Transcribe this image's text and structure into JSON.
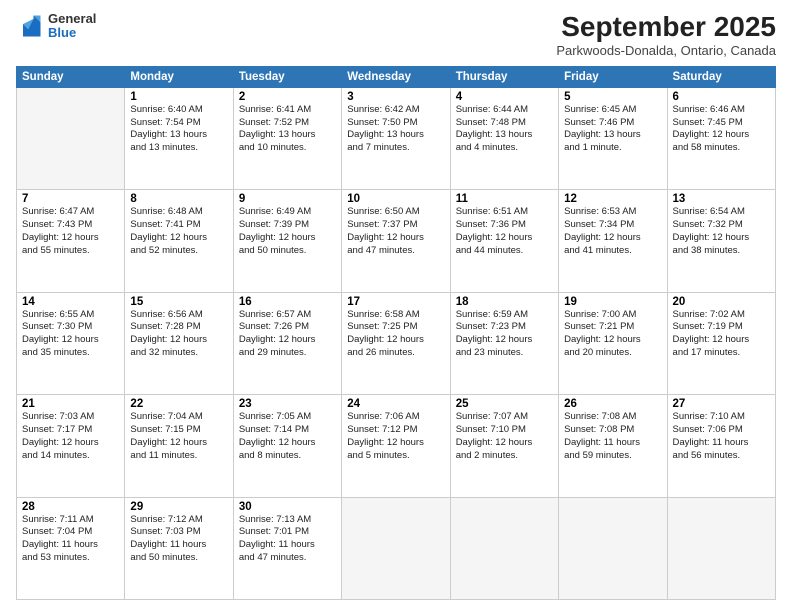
{
  "logo": {
    "general": "General",
    "blue": "Blue"
  },
  "title": "September 2025",
  "location": "Parkwoods-Donalda, Ontario, Canada",
  "days_header": [
    "Sunday",
    "Monday",
    "Tuesday",
    "Wednesday",
    "Thursday",
    "Friday",
    "Saturday"
  ],
  "weeks": [
    [
      {
        "day": "",
        "info": ""
      },
      {
        "day": "1",
        "info": "Sunrise: 6:40 AM\nSunset: 7:54 PM\nDaylight: 13 hours\nand 13 minutes."
      },
      {
        "day": "2",
        "info": "Sunrise: 6:41 AM\nSunset: 7:52 PM\nDaylight: 13 hours\nand 10 minutes."
      },
      {
        "day": "3",
        "info": "Sunrise: 6:42 AM\nSunset: 7:50 PM\nDaylight: 13 hours\nand 7 minutes."
      },
      {
        "day": "4",
        "info": "Sunrise: 6:44 AM\nSunset: 7:48 PM\nDaylight: 13 hours\nand 4 minutes."
      },
      {
        "day": "5",
        "info": "Sunrise: 6:45 AM\nSunset: 7:46 PM\nDaylight: 13 hours\nand 1 minute."
      },
      {
        "day": "6",
        "info": "Sunrise: 6:46 AM\nSunset: 7:45 PM\nDaylight: 12 hours\nand 58 minutes."
      }
    ],
    [
      {
        "day": "7",
        "info": "Sunrise: 6:47 AM\nSunset: 7:43 PM\nDaylight: 12 hours\nand 55 minutes."
      },
      {
        "day": "8",
        "info": "Sunrise: 6:48 AM\nSunset: 7:41 PM\nDaylight: 12 hours\nand 52 minutes."
      },
      {
        "day": "9",
        "info": "Sunrise: 6:49 AM\nSunset: 7:39 PM\nDaylight: 12 hours\nand 50 minutes."
      },
      {
        "day": "10",
        "info": "Sunrise: 6:50 AM\nSunset: 7:37 PM\nDaylight: 12 hours\nand 47 minutes."
      },
      {
        "day": "11",
        "info": "Sunrise: 6:51 AM\nSunset: 7:36 PM\nDaylight: 12 hours\nand 44 minutes."
      },
      {
        "day": "12",
        "info": "Sunrise: 6:53 AM\nSunset: 7:34 PM\nDaylight: 12 hours\nand 41 minutes."
      },
      {
        "day": "13",
        "info": "Sunrise: 6:54 AM\nSunset: 7:32 PM\nDaylight: 12 hours\nand 38 minutes."
      }
    ],
    [
      {
        "day": "14",
        "info": "Sunrise: 6:55 AM\nSunset: 7:30 PM\nDaylight: 12 hours\nand 35 minutes."
      },
      {
        "day": "15",
        "info": "Sunrise: 6:56 AM\nSunset: 7:28 PM\nDaylight: 12 hours\nand 32 minutes."
      },
      {
        "day": "16",
        "info": "Sunrise: 6:57 AM\nSunset: 7:26 PM\nDaylight: 12 hours\nand 29 minutes."
      },
      {
        "day": "17",
        "info": "Sunrise: 6:58 AM\nSunset: 7:25 PM\nDaylight: 12 hours\nand 26 minutes."
      },
      {
        "day": "18",
        "info": "Sunrise: 6:59 AM\nSunset: 7:23 PM\nDaylight: 12 hours\nand 23 minutes."
      },
      {
        "day": "19",
        "info": "Sunrise: 7:00 AM\nSunset: 7:21 PM\nDaylight: 12 hours\nand 20 minutes."
      },
      {
        "day": "20",
        "info": "Sunrise: 7:02 AM\nSunset: 7:19 PM\nDaylight: 12 hours\nand 17 minutes."
      }
    ],
    [
      {
        "day": "21",
        "info": "Sunrise: 7:03 AM\nSunset: 7:17 PM\nDaylight: 12 hours\nand 14 minutes."
      },
      {
        "day": "22",
        "info": "Sunrise: 7:04 AM\nSunset: 7:15 PM\nDaylight: 12 hours\nand 11 minutes."
      },
      {
        "day": "23",
        "info": "Sunrise: 7:05 AM\nSunset: 7:14 PM\nDaylight: 12 hours\nand 8 minutes."
      },
      {
        "day": "24",
        "info": "Sunrise: 7:06 AM\nSunset: 7:12 PM\nDaylight: 12 hours\nand 5 minutes."
      },
      {
        "day": "25",
        "info": "Sunrise: 7:07 AM\nSunset: 7:10 PM\nDaylight: 12 hours\nand 2 minutes."
      },
      {
        "day": "26",
        "info": "Sunrise: 7:08 AM\nSunset: 7:08 PM\nDaylight: 11 hours\nand 59 minutes."
      },
      {
        "day": "27",
        "info": "Sunrise: 7:10 AM\nSunset: 7:06 PM\nDaylight: 11 hours\nand 56 minutes."
      }
    ],
    [
      {
        "day": "28",
        "info": "Sunrise: 7:11 AM\nSunset: 7:04 PM\nDaylight: 11 hours\nand 53 minutes."
      },
      {
        "day": "29",
        "info": "Sunrise: 7:12 AM\nSunset: 7:03 PM\nDaylight: 11 hours\nand 50 minutes."
      },
      {
        "day": "30",
        "info": "Sunrise: 7:13 AM\nSunset: 7:01 PM\nDaylight: 11 hours\nand 47 minutes."
      },
      {
        "day": "",
        "info": ""
      },
      {
        "day": "",
        "info": ""
      },
      {
        "day": "",
        "info": ""
      },
      {
        "day": "",
        "info": ""
      }
    ]
  ]
}
